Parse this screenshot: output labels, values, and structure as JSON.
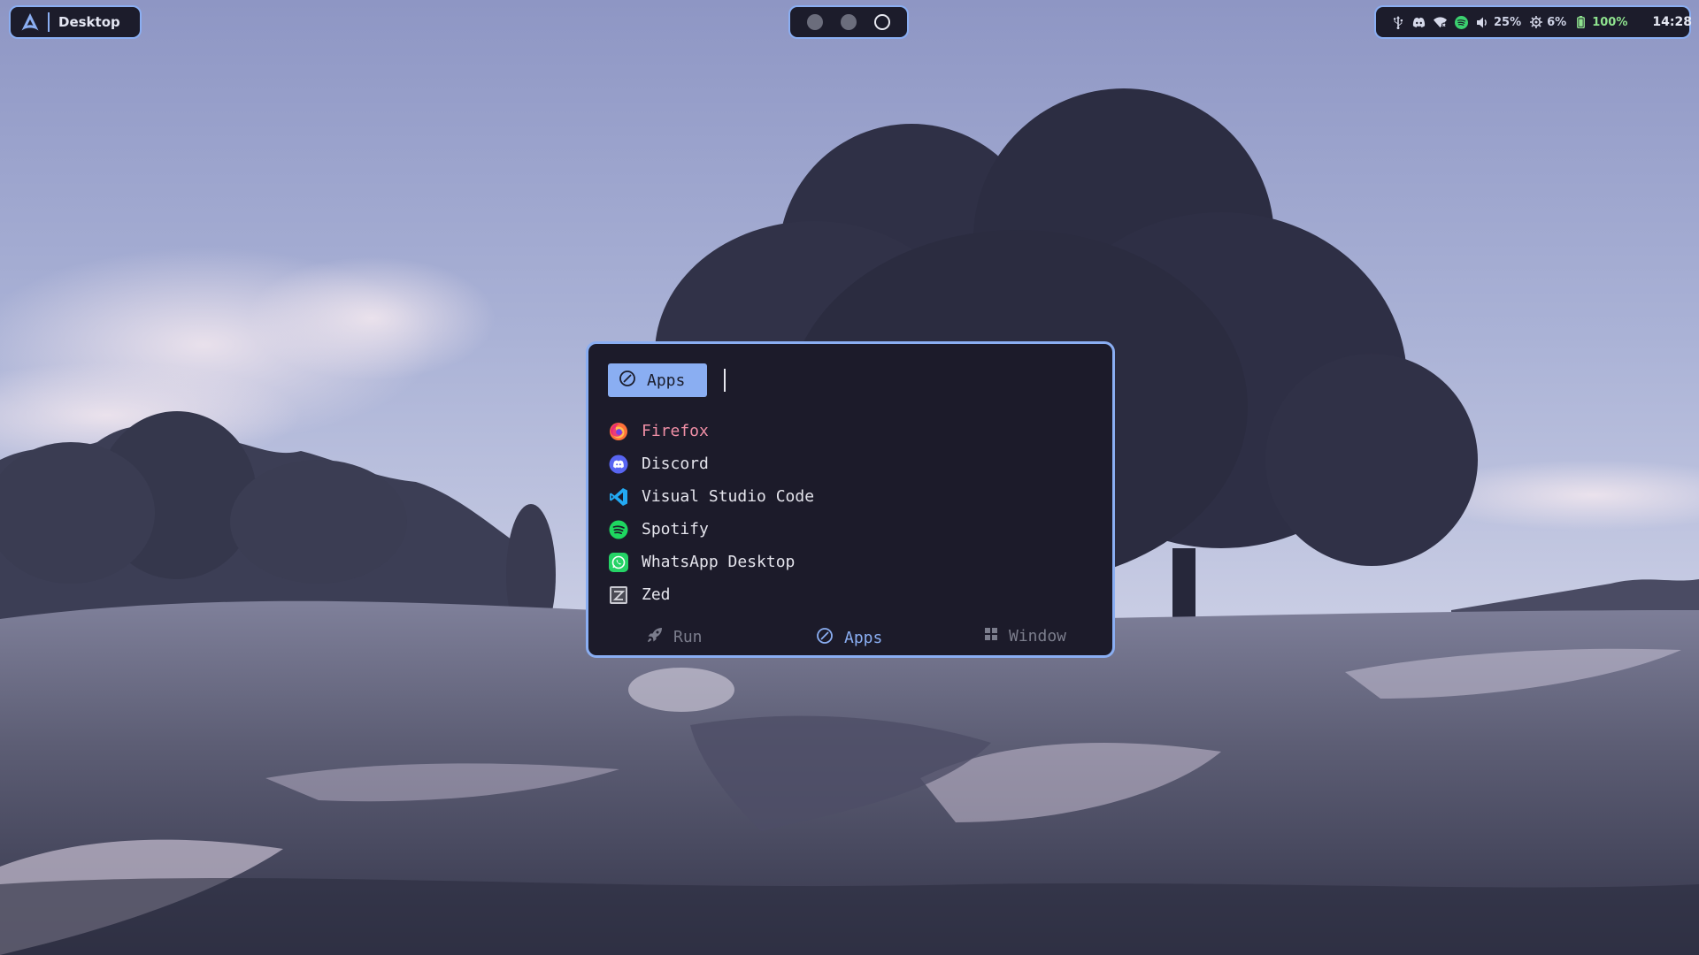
{
  "topbar": {
    "left": {
      "logo_icon": "arch-linux-logo",
      "workspace_name": "Desktop"
    },
    "workspaces": [
      {
        "state": "occupied"
      },
      {
        "state": "occupied"
      },
      {
        "state": "active"
      }
    ],
    "tray": {
      "icons": [
        "usb-icon",
        "discord-icon",
        "wifi-icon",
        "spotify-icon"
      ],
      "volume": "25%",
      "cpu": "6%",
      "battery": "100%",
      "clock": "14:28"
    }
  },
  "launcher": {
    "mode_chip": {
      "icon": "apps-icon",
      "label": "Apps"
    },
    "search_value": "",
    "apps": [
      {
        "label": "Firefox",
        "icon": "firefox-icon",
        "selected": true
      },
      {
        "label": "Discord",
        "icon": "discord-icon"
      },
      {
        "label": "Visual Studio Code",
        "icon": "vscode-icon"
      },
      {
        "label": "Spotify",
        "icon": "spotify-icon"
      },
      {
        "label": "WhatsApp Desktop",
        "icon": "whatsapp-icon"
      },
      {
        "label": "Zed",
        "icon": "zed-icon"
      }
    ],
    "modes": [
      {
        "label": "Run",
        "icon": "rocket-icon"
      },
      {
        "label": "Apps",
        "icon": "apps-icon",
        "active": true
      },
      {
        "label": "Window",
        "icon": "window-grid-icon"
      }
    ]
  },
  "colors": {
    "accent": "#8aaef2",
    "panel": "#1c1b2a",
    "selected_text": "#f08fa6",
    "green_status": "#8fe38f"
  }
}
